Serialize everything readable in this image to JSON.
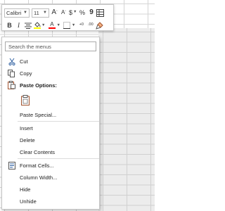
{
  "mini_toolbar": {
    "font_name": "Calibri",
    "font_size": "11",
    "increase_font_label": "A",
    "decrease_font_label": "A",
    "currency_label": "$",
    "percent_label": "%",
    "comma_label": "9",
    "bold_label": "B",
    "italic_label": "I",
    "font_color_label": "A",
    "increase_decimal_label": "+0",
    "decrease_decimal_label": ".00",
    "fill_color": "#ffff00",
    "font_color": "#ff0000"
  },
  "context_menu": {
    "search_placeholder": "Search the menus",
    "cut": "Cut",
    "copy": "Copy",
    "paste_options": "Paste Options:",
    "paste_special": "Paste Special...",
    "insert": "Insert",
    "delete": "Delete",
    "clear_contents": "Clear Contents",
    "format_cells": "Format Cells...",
    "column_width": "Column Width...",
    "hide": "Hide",
    "unhide": "Unhide"
  },
  "icons": {
    "cut": "scissors-icon",
    "copy": "copy-icon",
    "paste_options": "clipboard-icon",
    "paste_keep": "paste-clipboard-icon",
    "format_cells": "format-cells-icon"
  }
}
